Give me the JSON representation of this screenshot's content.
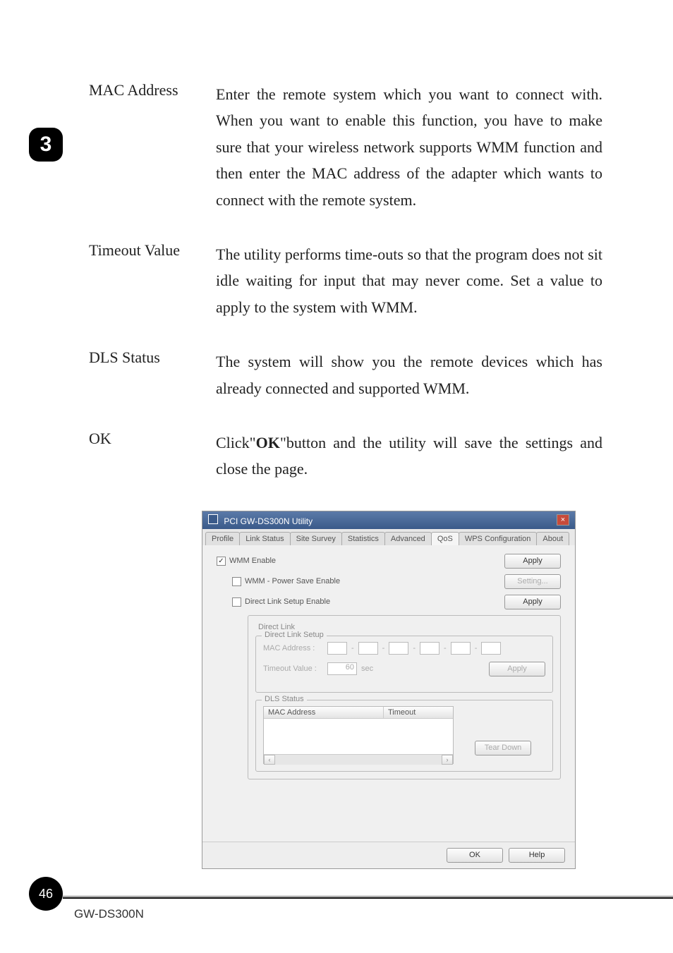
{
  "chapter_number": "3",
  "definitions": [
    {
      "term": "MAC Address",
      "desc": "Enter the remote system which you want to connect with. When you want to enable this function, you have to make sure that your wireless network supports WMM function and then enter the MAC address of the adapter which wants to connect with the remote system."
    },
    {
      "term": "Timeout Value",
      "desc": "The utility performs time-outs so that the program does not sit idle waiting for input that may never come. Set a value to apply to the system with WMM."
    },
    {
      "term": "DLS Status",
      "desc": "The system will show you the remote devices which has already connected and supported WMM."
    },
    {
      "term": "OK",
      "desc_pre": "Click\"",
      "desc_bold": "OK",
      "desc_post": "\"button and the utility will save the settings and close the page."
    }
  ],
  "dialog": {
    "title": "PCI GW-DS300N Utility",
    "tabs": [
      "Profile",
      "Link Status",
      "Site Survey",
      "Statistics",
      "Advanced",
      "QoS",
      "WPS Configuration",
      "About"
    ],
    "active_tab": "QoS",
    "wmm_enable": {
      "label": "WMM Enable",
      "checked": true
    },
    "wmm_ps": {
      "label": "WMM - Power Save Enable",
      "checked": false
    },
    "dls_enable": {
      "label": "Direct Link Setup Enable",
      "checked": false
    },
    "apply1": "Apply",
    "setting": "Setting...",
    "apply2": "Apply",
    "direct_link_group": "Direct Link",
    "dls_setup_group": "Direct Link Setup",
    "mac_label": "MAC Address :",
    "timeout_label": "Timeout Value :",
    "timeout_value": "60",
    "timeout_unit": "sec",
    "apply3": "Apply",
    "dls_status_group": "DLS Status",
    "dls_headers": {
      "col1": "MAC Address",
      "col2": "Timeout"
    },
    "teardown": "Tear Down",
    "ok": "OK",
    "help": "Help"
  },
  "page_number": "46",
  "product": "GW-DS300N"
}
